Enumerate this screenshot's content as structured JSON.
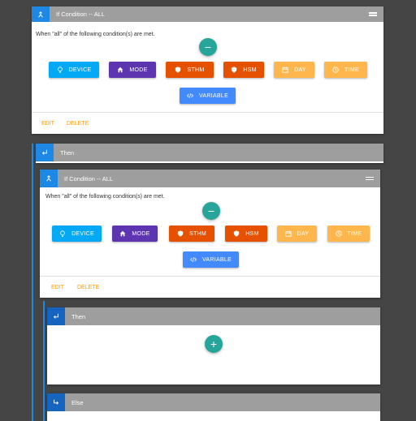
{
  "colors": {
    "device": "#03a9f4",
    "mode": "#5e35b1",
    "sthm": "#e65100",
    "hsm": "#e65100",
    "day": "#ffb74d",
    "time": "#ffb74d",
    "variable": "#448aff",
    "fab": "#26a69a",
    "link": "#ff9800"
  },
  "outer_condition": {
    "title": "If Condition -- ALL",
    "description": "When \"all\" of the following condition(s) are met.",
    "fab_symbol": "−",
    "buttons": {
      "device": "DEVICE",
      "mode": "MODE",
      "sthm": "STHM",
      "hsm": "HSM",
      "day": "DAY",
      "time": "TIME",
      "variable": "VARIABLE"
    },
    "edit": "EDIT",
    "delete": "DELETE"
  },
  "then_block": {
    "title": "Then"
  },
  "inner_condition": {
    "title": "If Condition -- ALL",
    "description": "When \"all\" of the following condition(s) are met.",
    "fab_symbol": "−",
    "buttons": {
      "device": "DEVICE",
      "mode": "MODE",
      "sthm": "STHM",
      "hsm": "HSM",
      "day": "DAY",
      "time": "TIME",
      "variable": "VARIABLE"
    },
    "edit": "EDIT",
    "delete": "DELETE"
  },
  "inner_then": {
    "title": "Then",
    "fab_symbol": "+"
  },
  "else_block": {
    "title": "Else"
  }
}
